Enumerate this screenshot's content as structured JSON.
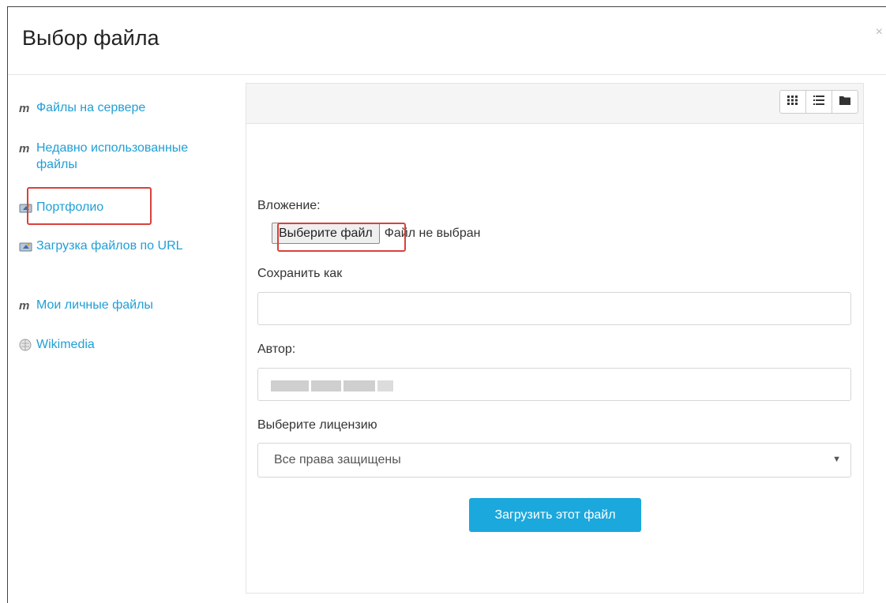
{
  "dialog": {
    "title": "Выбор файла",
    "close_label": "×"
  },
  "sidebar": {
    "items": [
      {
        "label": "Файлы на сервере",
        "icon": "moodle-icon"
      },
      {
        "label": "Недавно использованные файлы",
        "icon": "moodle-icon"
      },
      {
        "label": "Портфолио",
        "icon": "portfolio-icon"
      },
      {
        "label": "Загрузка файлов по URL",
        "icon": "url-download-icon"
      },
      {
        "label": "Мои личные файлы",
        "icon": "moodle-icon"
      },
      {
        "label": "Wikimedia",
        "icon": "wikimedia-icon"
      }
    ]
  },
  "toolbar": {
    "view_buttons": [
      "grid-view-icon",
      "list-view-icon",
      "folder-view-icon"
    ]
  },
  "form": {
    "attachment_label": "Вложение:",
    "choose_file_button": "Выберите файл",
    "file_status": "Файл не выбран",
    "save_as_label": "Сохранить как",
    "save_as_value": "",
    "author_label": "Автор:",
    "license_label": "Выберите лицензию",
    "license_value": "Все права защищены",
    "upload_button": "Загрузить этот файл"
  },
  "colors": {
    "link": "#1f9fd6",
    "upload_button": "#1ba8dd",
    "highlight": "#d9413a"
  }
}
